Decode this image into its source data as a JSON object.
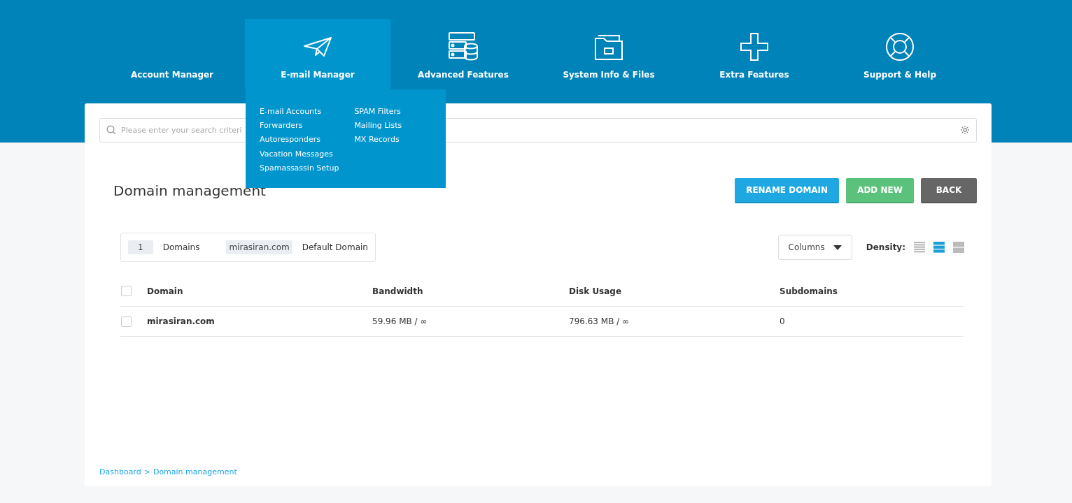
{
  "nav": [
    {
      "label": "Account Manager",
      "selected": false,
      "kind": "hidden"
    },
    {
      "label": "E-mail Manager",
      "selected": true,
      "kind": "plane"
    },
    {
      "label": "Advanced Features",
      "selected": false,
      "kind": "server"
    },
    {
      "label": "System Info & Files",
      "selected": false,
      "kind": "folder"
    },
    {
      "label": "Extra Features",
      "selected": false,
      "kind": "plus"
    },
    {
      "label": "Support & Help",
      "selected": false,
      "kind": "lifebuoy"
    }
  ],
  "dropdown": {
    "columns": [
      [
        "E-mail Accounts",
        "Forwarders",
        "Autoresponders",
        "Vacation Messages",
        "Spamassassin Setup"
      ],
      [
        "SPAM Filters",
        "Mailing Lists",
        "MX Records"
      ]
    ]
  },
  "search": {
    "placeholder": "Please enter your search criteri"
  },
  "page_title": "Domain management",
  "actions": [
    {
      "label": "RENAME DOMAIN",
      "kind": "info"
    },
    {
      "label": "ADD NEW",
      "kind": "success"
    },
    {
      "label": "BACK",
      "kind": "dark"
    }
  ],
  "summary": {
    "count": "1",
    "count_label": "Domains",
    "default_domain": "mirasiran.com",
    "default_label": "Default Domain"
  },
  "columns_button": "Columns",
  "density": {
    "label": "Density:",
    "options": [
      {
        "selected": false,
        "kind": "compact"
      },
      {
        "selected": true,
        "kind": "normal"
      },
      {
        "selected": false,
        "kind": "large"
      }
    ]
  },
  "table": {
    "columns": [
      "Domain",
      "Bandwidth",
      "Disk Usage",
      "Subdomains"
    ],
    "header_checked": false,
    "rows": [
      {
        "checked": false,
        "cells": [
          "mirasiran.com",
          "59.96 MB / ∞",
          "796.63 MB / ∞",
          "0"
        ]
      }
    ]
  },
  "breadcrumb": [
    "Dashboard",
    "Domain management"
  ],
  "breadcrumb_separator": ">"
}
